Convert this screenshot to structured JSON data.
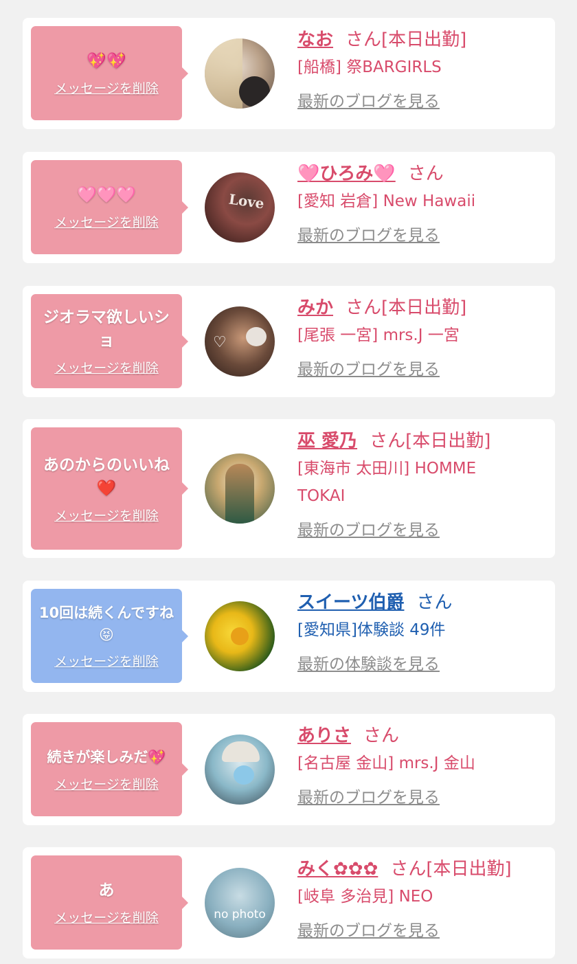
{
  "delete_label": "メッセージを削除",
  "san_label": "さん",
  "cards": [
    {
      "message": "💖💖",
      "name": "なお",
      "status": "[本日出勤]",
      "shop": "[船橋] 祭BARGIRLS",
      "link": "最新のブログを見る",
      "theme": "pink"
    },
    {
      "message": "🩷🩷🩷",
      "name": "🩷ひろみ🩷",
      "status": "",
      "shop": "[愛知 岩倉] New Hawaii",
      "link": "最新のブログを見る",
      "theme": "pink"
    },
    {
      "message": "ジオラマ欲しいショ",
      "name": "みか",
      "status": "[本日出勤]",
      "shop": "[尾張 一宮] mrs.J 一宮",
      "link": "最新のブログを見る",
      "theme": "pink"
    },
    {
      "message": "あのからのいいね❤️",
      "name": "巫 愛乃",
      "status": "[本日出勤]",
      "shop": "[東海市 太田川] HOMME TOKAI",
      "link": "最新のブログを見る",
      "theme": "pink"
    },
    {
      "message": "10回は続くんですね😝",
      "name": "スイーツ伯爵",
      "status": "",
      "shop": "[愛知県]体験談 49件",
      "link": "最新の体験談を見る",
      "theme": "blue"
    },
    {
      "message": "続きが楽しみだ💖",
      "name": "ありさ",
      "status": "",
      "shop": "[名古屋 金山] mrs.J 金山",
      "link": "最新のブログを見る",
      "theme": "pink"
    },
    {
      "message": "あ",
      "name": "みく✿✿✿",
      "status": "[本日出勤]",
      "shop": "[岐阜 多治見] NEO",
      "link": "最新のブログを見る",
      "theme": "pink",
      "avatar_text": "no photo"
    }
  ],
  "colors": {
    "background": "#f1f1f1",
    "bubble_pink": "#ee9aa6",
    "bubble_blue": "#93b6ef",
    "name_pink": "#d84b6b",
    "name_blue": "#1f5fb0",
    "link_gray": "#8c8c8c"
  }
}
